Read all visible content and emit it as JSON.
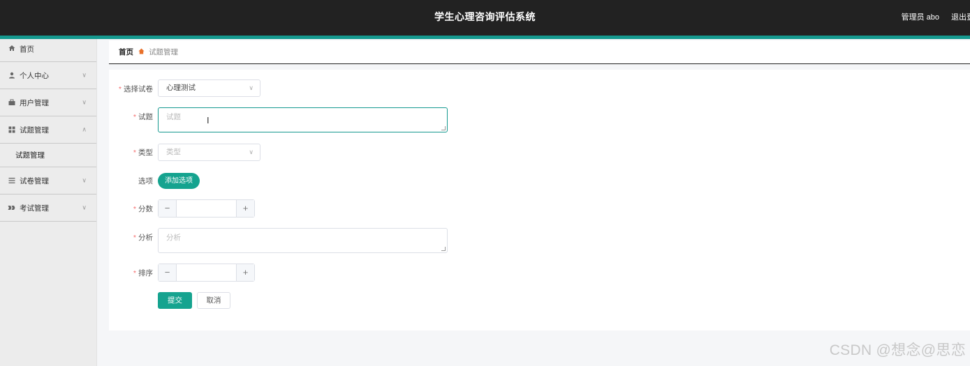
{
  "app": {
    "title": "学生心理咨询评估系统",
    "user": "管理员 abo",
    "logout": "退出登"
  },
  "sidebar": {
    "items": [
      {
        "label": "首页",
        "icon": "home-icon"
      },
      {
        "label": "个人中心",
        "icon": "user-icon"
      },
      {
        "label": "用户管理",
        "icon": "briefcase-icon"
      },
      {
        "label": "试题管理",
        "icon": "grid-icon",
        "expanded": true,
        "children": [
          {
            "label": "试题管理"
          }
        ]
      },
      {
        "label": "试卷管理",
        "icon": "list-icon"
      },
      {
        "label": "考试管理",
        "icon": "tag-icon"
      }
    ]
  },
  "breadcrumb": {
    "home": "首页",
    "current": "试题管理"
  },
  "form": {
    "paper": {
      "label": "选择试卷",
      "value": "心理测试"
    },
    "question": {
      "label": "试题",
      "placeholder": "试题"
    },
    "type": {
      "label": "类型",
      "placeholder": "类型"
    },
    "options": {
      "label": "选项",
      "add_button": "添加选项"
    },
    "score": {
      "label": "分数",
      "value": ""
    },
    "analysis": {
      "label": "分析",
      "placeholder": "分析"
    },
    "order": {
      "label": "排序",
      "value": ""
    },
    "submit": "提交",
    "cancel": "取消"
  },
  "watermark": "CSDN @想念@思恋"
}
